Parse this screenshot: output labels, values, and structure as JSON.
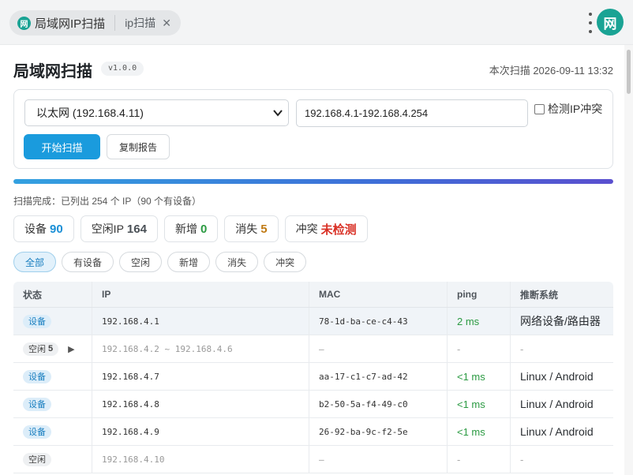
{
  "tabs": {
    "app_badge": "网",
    "active_label": "局域网IP扫描",
    "second_label": "ip扫描",
    "close_glyph": "✕"
  },
  "avatar_text": "网",
  "header": {
    "title": "局域网扫描",
    "version": "v1.0.0",
    "scan_time": "本次扫描 2026-09-11 13:32"
  },
  "config": {
    "interface_value": "以太网 (192.168.4.11)",
    "range_value": "192.168.4.1-192.168.4.254",
    "conflict_check_label": "检测IP冲突",
    "conflict_check_checked": false,
    "start_button": "开始扫描",
    "copy_button": "复制报告"
  },
  "progress": {
    "percent": 100
  },
  "status_text": "扫描完成：已列出 254 个 IP（90 个有设备）",
  "stats": [
    {
      "label": "设备",
      "value": "90",
      "color": "#1a8fd6"
    },
    {
      "label": "空闲IP",
      "value": "164",
      "color": "#4a5056"
    },
    {
      "label": "新增",
      "value": "0",
      "color": "#2b9a42"
    },
    {
      "label": "消失",
      "value": "5",
      "color": "#c07a14"
    },
    {
      "label": "冲突",
      "value": "未检测",
      "color": "#d93025"
    }
  ],
  "filters": [
    "全部",
    "有设备",
    "空闲",
    "新增",
    "消失",
    "冲突"
  ],
  "active_filter": "全部",
  "table": {
    "headers": [
      "状态",
      "IP",
      "MAC",
      "ping",
      "推断系统"
    ],
    "rows": [
      {
        "status": "设备",
        "kind": "dev",
        "ip": "192.168.4.1",
        "mac": "78-1d-ba-ce-c4-43",
        "ping": "2 ms",
        "os": "网络设备/路由器",
        "highlight": true
      },
      {
        "status": "空闲",
        "kind": "idle",
        "count": "5",
        "expandable": true,
        "ip": "192.168.4.2 ~ 192.168.4.6",
        "mac": "—",
        "ping": "-",
        "os": "-"
      },
      {
        "status": "设备",
        "kind": "dev",
        "ip": "192.168.4.7",
        "mac": "aa-17-c1-c7-ad-42",
        "ping": "<1 ms",
        "os": "Linux / Android"
      },
      {
        "status": "设备",
        "kind": "dev",
        "ip": "192.168.4.8",
        "mac": "b2-50-5a-f4-49-c0",
        "ping": "<1 ms",
        "os": "Linux / Android"
      },
      {
        "status": "设备",
        "kind": "dev",
        "ip": "192.168.4.9",
        "mac": "26-92-ba-9c-f2-5e",
        "ping": "<1 ms",
        "os": "Linux / Android"
      },
      {
        "status": "空闲",
        "kind": "idle",
        "ip": "192.168.4.10",
        "mac": "—",
        "ping": "-",
        "os": "-"
      }
    ]
  }
}
